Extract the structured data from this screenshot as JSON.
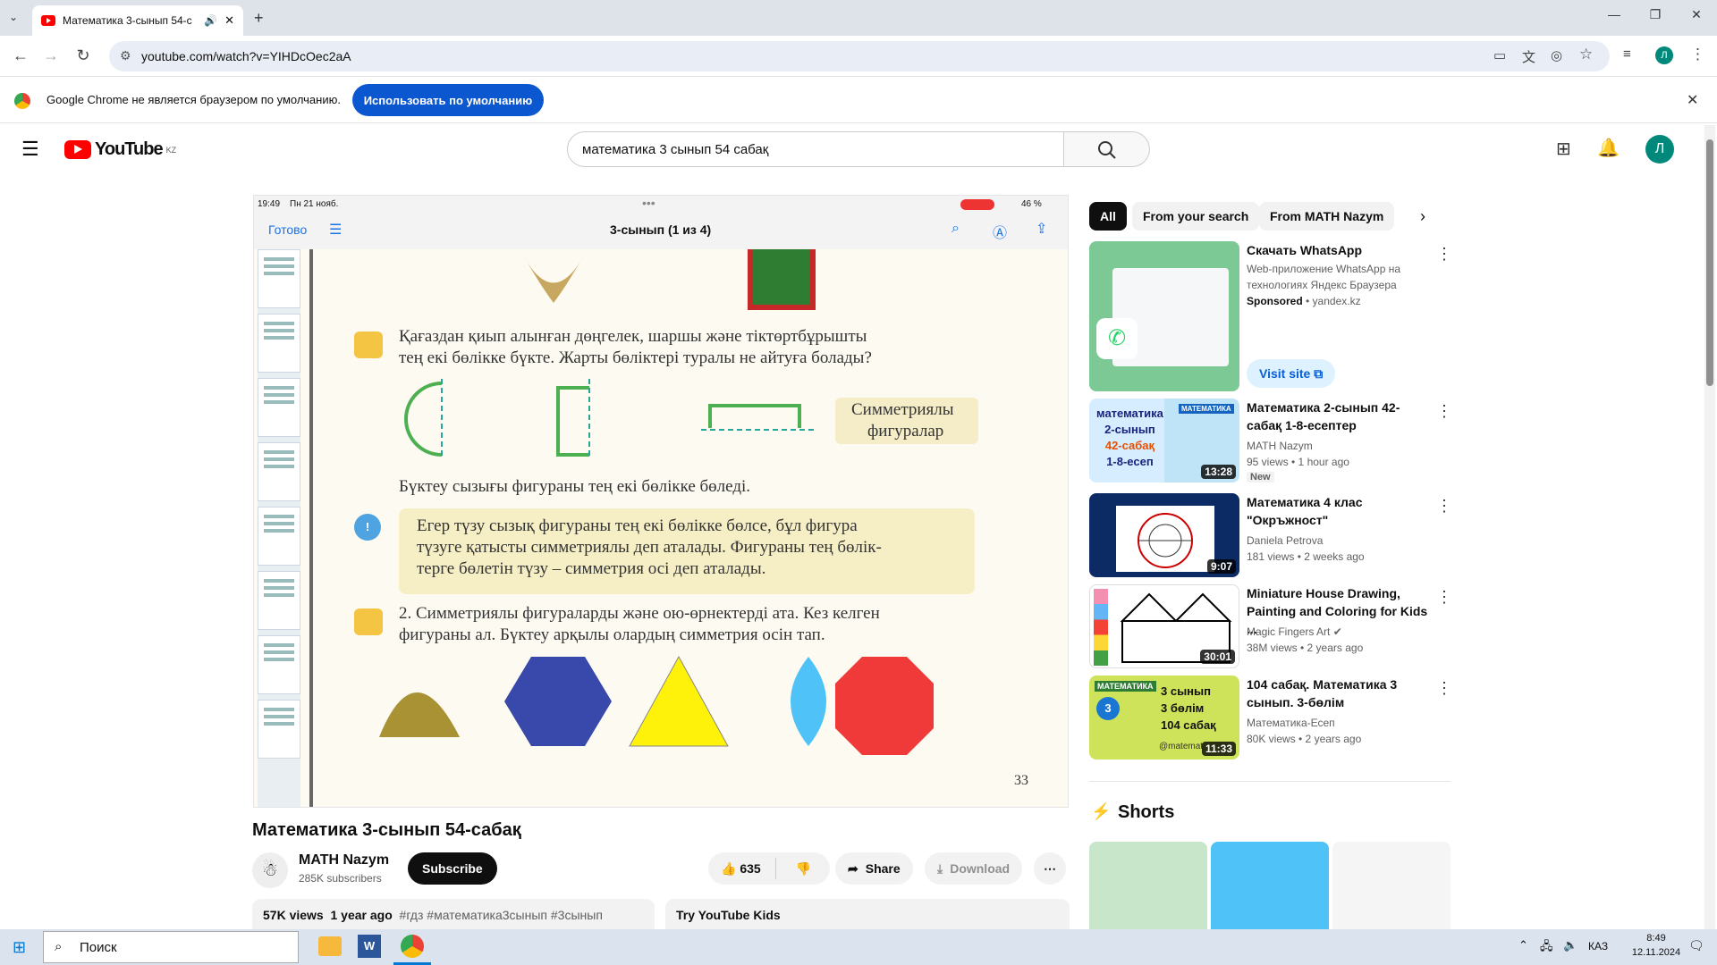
{
  "browser": {
    "tab_title": "Математика 3-сынып 54-с",
    "url": "youtube.com/watch?v=YIHDcOec2aA",
    "banner_text": "Google Chrome не является браузером по умолчанию.",
    "banner_button": "Использовать по умолчанию",
    "profile_letter": "Л"
  },
  "yt": {
    "logo": "YouTube",
    "region": "KZ",
    "search_value": "математика 3 сынып 54 сабақ",
    "avatar_letter": "Л"
  },
  "video": {
    "status_time": "19:49",
    "status_date": "Пн 21 нояб.",
    "battery": "46 %",
    "done": "Готово",
    "doc_title": "3-сынып (1 из 4)",
    "page_number": "33",
    "symmetry_label_1": "Симметриялы",
    "symmetry_label_2": "фигуралар",
    "text1a": "Қағаздан қиып алынған дөңгелек, шаршы және тіктөртбұрышты",
    "text1b": "тең екі бөлікке бүкте. Жарты бөліктері туралы не айтуға болады?",
    "text2": "Бүктеу сызығы фигураны тең екі бөлікке бөледі.",
    "rule1": "Егер түзу сызық фигураны тең екі бөлікке бөлсе, бұл фигура",
    "rule2": "түзуге қатысты симметриялы деп аталады. Фигураны тең бөлік-",
    "rule3": "терге бөлетін түзу – симметрия осі деп аталады.",
    "task1": "2. Симметриялы фигураларды және ою-өрнектерді ата. Кез келген",
    "task2": "фигураны ал. Бүктеу арқылы олардың симметрия осін тап."
  },
  "meta": {
    "title": "Математика 3-сынып 54-сабақ",
    "channel": "MATH Nazym",
    "subscribers": "285K subscribers",
    "subscribe": "Subscribe",
    "likes": "635",
    "share": "Share",
    "download": "Download",
    "views": "57K views",
    "age": "1 year ago",
    "tags": "#гдз #математика3сынып #3сынып",
    "kids": "Try YouTube Kids"
  },
  "sidebar": {
    "chips": [
      "All",
      "From your search",
      "From MATH Nazym"
    ],
    "ad": {
      "title": "Скачать WhatsApp",
      "desc1": "Web-приложение WhatsApp на",
      "desc2": "технологиях Яндекс Браузера",
      "sponsored": "Sponsored",
      "domain": "yandex.kz",
      "cta": "Visit site"
    },
    "videos": [
      {
        "title": "Математика 2-сынып 42-сабақ 1-8-есептер",
        "channel": "MATH Nazym",
        "stats": "95 views • 1 hour ago",
        "badge": "New",
        "duration": "13:28"
      },
      {
        "title": "Математика 4 клас \"Окръжност\"",
        "channel": "Daniela Petrova",
        "stats": "181 views • 2 weeks ago",
        "duration": "9:07"
      },
      {
        "title": "Miniature House Drawing, Painting and Coloring for Kids ...",
        "channel": "Magic Fingers Art",
        "stats": "38M views • 2 years ago",
        "duration": "30:01"
      },
      {
        "title": "104 сабақ. Математика 3 сынып. 3-бөлім",
        "channel": "Математика-Есеп",
        "stats": "80K views • 2 years ago",
        "duration": "11:33"
      }
    ],
    "thumb_text": {
      "v1a": "математика",
      "v1b": "2-сынып",
      "v1c": "42-сабақ",
      "v1d": "1-8-есеп",
      "v1e": "МАТЕМАТИКА",
      "v4a": "МАТЕМАТИКА",
      "v4b": "3 сынып",
      "v4c": "3 бөлім",
      "v4d": "104 сабақ",
      "v4e": "@matemat",
      "v4f": "3"
    },
    "shorts": "Shorts"
  },
  "taskbar": {
    "search": "Поиск",
    "lang": "КАЗ",
    "time": "8:49",
    "date": "12.11.2024"
  },
  "colors": {
    "accent": "#0b57d0",
    "yt_red": "#ff0000",
    "teal": "#00897b"
  }
}
